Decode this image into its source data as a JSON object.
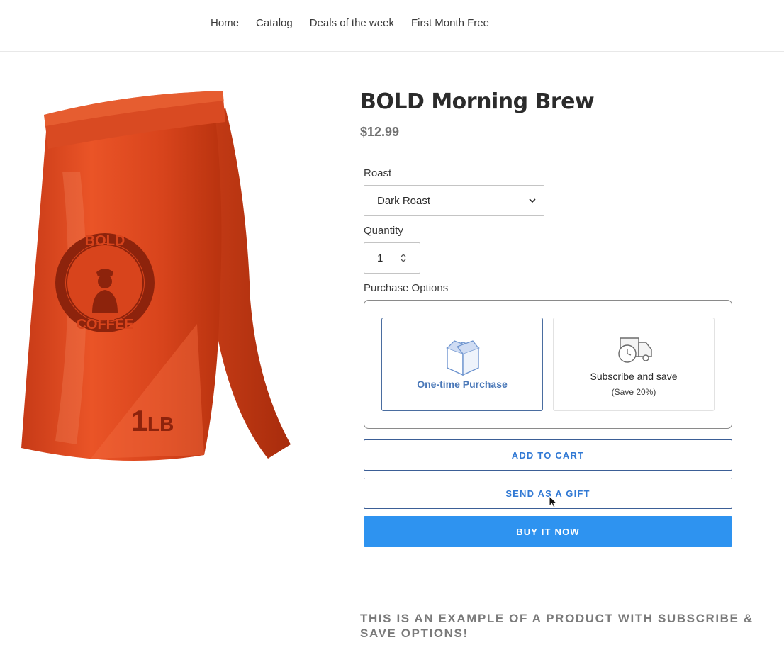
{
  "nav": {
    "items": [
      "Home",
      "Catalog",
      "Deals of the week",
      "First Month Free"
    ]
  },
  "product": {
    "title": "BOLD Morning Brew",
    "price": "$12.99",
    "image": {
      "brand_top": "BOLD",
      "brand_bottom": "COFFEE",
      "weight_number": "1",
      "weight_unit": "LB"
    }
  },
  "roast": {
    "label": "Roast",
    "selected": "Dark Roast"
  },
  "quantity": {
    "label": "Quantity",
    "value": "1"
  },
  "purchase_options": {
    "label": "Purchase Options",
    "one_time_label": "One-time Purchase",
    "subscribe_label": "Subscribe and save",
    "subscribe_note": "(Save 20%)",
    "one_time_icon": "open-box-icon",
    "subscribe_icon": "delivery-truck-clock-icon"
  },
  "buttons": {
    "add_to_cart": "ADD TO CART",
    "send_gift": "SEND AS A GIFT",
    "buy_now": "BUY IT NOW"
  },
  "promo_text": "THIS IS AN EXAMPLE OF A PRODUCT WITH SUBSCRIBE & SAVE OPTIONS!",
  "colors": {
    "bag": "#e2471f",
    "accent_blue": "#2e93f0",
    "selected_option_border": "#4a6da0",
    "option_label_blue": "#4a78b8"
  }
}
